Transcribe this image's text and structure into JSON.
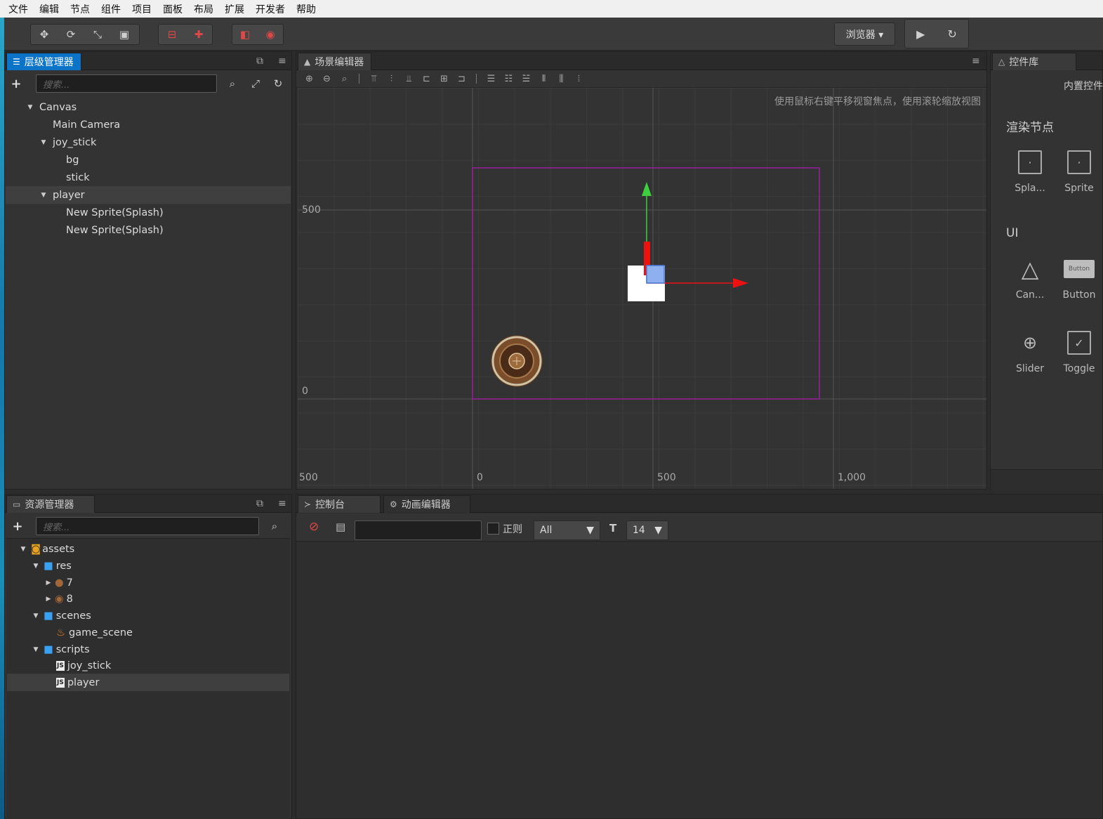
{
  "menu": [
    "文件",
    "编辑",
    "节点",
    "组件",
    "项目",
    "面板",
    "布局",
    "扩展",
    "开发者",
    "帮助"
  ],
  "toolbar": {
    "transform_tools": [
      "move-icon",
      "rotate-icon",
      "scale-icon",
      "rect-icon"
    ],
    "pivot_tools": [
      "pivot-icon",
      "coordinate-icon"
    ],
    "preview_tools": [
      "fit-icon",
      "gizmo-icon"
    ],
    "browser_label": "浏览器 ▾",
    "play_label": "▶",
    "refresh_label": "↻"
  },
  "hierarchy": {
    "tab_label": "层级管理器",
    "search_placeholder": "搜索...",
    "nodes": [
      {
        "label": "Canvas"
      },
      {
        "label": "Main Camera"
      },
      {
        "label": "joy_stick"
      },
      {
        "label": "bg"
      },
      {
        "label": "stick"
      },
      {
        "label": "player"
      },
      {
        "label": "New Sprite(Splash)"
      },
      {
        "label": "New Sprite(Splash)"
      }
    ]
  },
  "scene": {
    "tab_label": "场景编辑器",
    "hint": "使用鼠标右键平移视窗焦点，使用滚轮缩放视图",
    "axis_left": [
      "500",
      "0"
    ],
    "axis_bottom": [
      "500",
      "0",
      "500",
      "1,000"
    ]
  },
  "library": {
    "tab_label": "控件库",
    "subtitle": "内置控件",
    "section_render": "渲染节点",
    "section_ui": "UI",
    "items": [
      {
        "label": "Spla..."
      },
      {
        "label": "Sprite"
      },
      {
        "label": "Can..."
      },
      {
        "label": "Button"
      },
      {
        "label": "Slider"
      },
      {
        "label": "Toggle"
      }
    ],
    "button_preview_text": "Button"
  },
  "assets": {
    "tab_label": "资源管理器",
    "search_placeholder": "搜索...",
    "nodes": [
      {
        "label": "assets"
      },
      {
        "label": "res"
      },
      {
        "label": "7"
      },
      {
        "label": "8"
      },
      {
        "label": "scenes"
      },
      {
        "label": "game_scene"
      },
      {
        "label": "scripts"
      },
      {
        "label": "joy_stick"
      },
      {
        "label": "player"
      }
    ]
  },
  "console": {
    "tab_label": "控制台",
    "anim_tab_label": "动画编辑器",
    "regex_label": "正则",
    "level_value": "All",
    "font_size_value": "14"
  }
}
